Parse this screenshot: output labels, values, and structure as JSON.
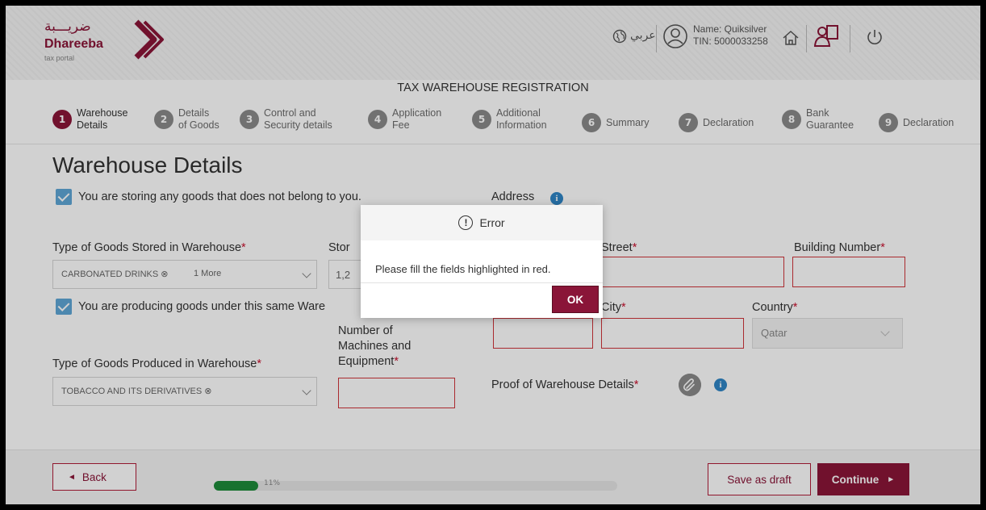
{
  "header": {
    "logo_arabic": "ضريـــبة",
    "logo_english": "Dhareeba",
    "logo_sub": "tax portal",
    "language_toggle": "عربي",
    "user_name": "Name: Quiksilver",
    "user_tin": "TIN: 5000033258",
    "icons": [
      "globe-icon",
      "user-icon",
      "home-icon",
      "people-icon",
      "power-icon"
    ]
  },
  "page": {
    "registration_title": "TAX WAREHOUSE REGISTRATION",
    "title": "Warehouse Details"
  },
  "steps": [
    {
      "num": "1",
      "line1": "Warehouse",
      "line2": "Details",
      "active": true
    },
    {
      "num": "2",
      "line1": "Details",
      "line2": "of Goods"
    },
    {
      "num": "3",
      "line1": "Control and",
      "line2": "Security details"
    },
    {
      "num": "4",
      "line1": "Application",
      "line2": "Fee"
    },
    {
      "num": "5",
      "line1": "Additional",
      "line2": "Information"
    },
    {
      "num": "6",
      "line1": "Summary",
      "line2": ""
    },
    {
      "num": "7",
      "line1": "Declaration",
      "line2": ""
    },
    {
      "num": "8",
      "line1": "Bank",
      "line2": "Guarantee"
    },
    {
      "num": "9",
      "line1": "Declaration",
      "line2": ""
    }
  ],
  "form": {
    "storing_checkbox_label": "You are storing any goods that does not belong to you.",
    "storing_checked": true,
    "goods_stored_label": "Type of Goods Stored in Warehouse",
    "goods_stored_chip": "CARBONATED DRINKS",
    "goods_stored_more": "1 More",
    "storage_label_partial": "Stor",
    "storage_value_partial": "1,2",
    "producing_checkbox_label": "You are producing goods under this same Ware",
    "producing_checked": true,
    "goods_produced_label": "Type of Goods Produced in Warehouse",
    "goods_produced_chip": "TOBACCO AND ITS DERIVATIVES",
    "machines_label_1": "Number of",
    "machines_label_2": "Machines and",
    "machines_label_3": "Equipment",
    "address_label": "Address",
    "street_label": "Street",
    "building_label": "Building Number",
    "city_label": "City",
    "country_label": "Country",
    "country_value": "Qatar",
    "proof_label": "Proof of Warehouse Details",
    "required_mark": "*"
  },
  "footer": {
    "back_label": "Back",
    "progress_percent": 11,
    "progress_text": "11%",
    "save_draft_label": "Save as draft",
    "continue_label": "Continue"
  },
  "modal": {
    "title": "Error",
    "message": "Please fill the fields highlighted in red.",
    "ok_label": "OK"
  },
  "colors": {
    "brand": "#8a1538",
    "error_border": "#d0343a",
    "checkbox": "#5fa6d6",
    "progress": "#1e8b3a",
    "info": "#2f86c6"
  }
}
